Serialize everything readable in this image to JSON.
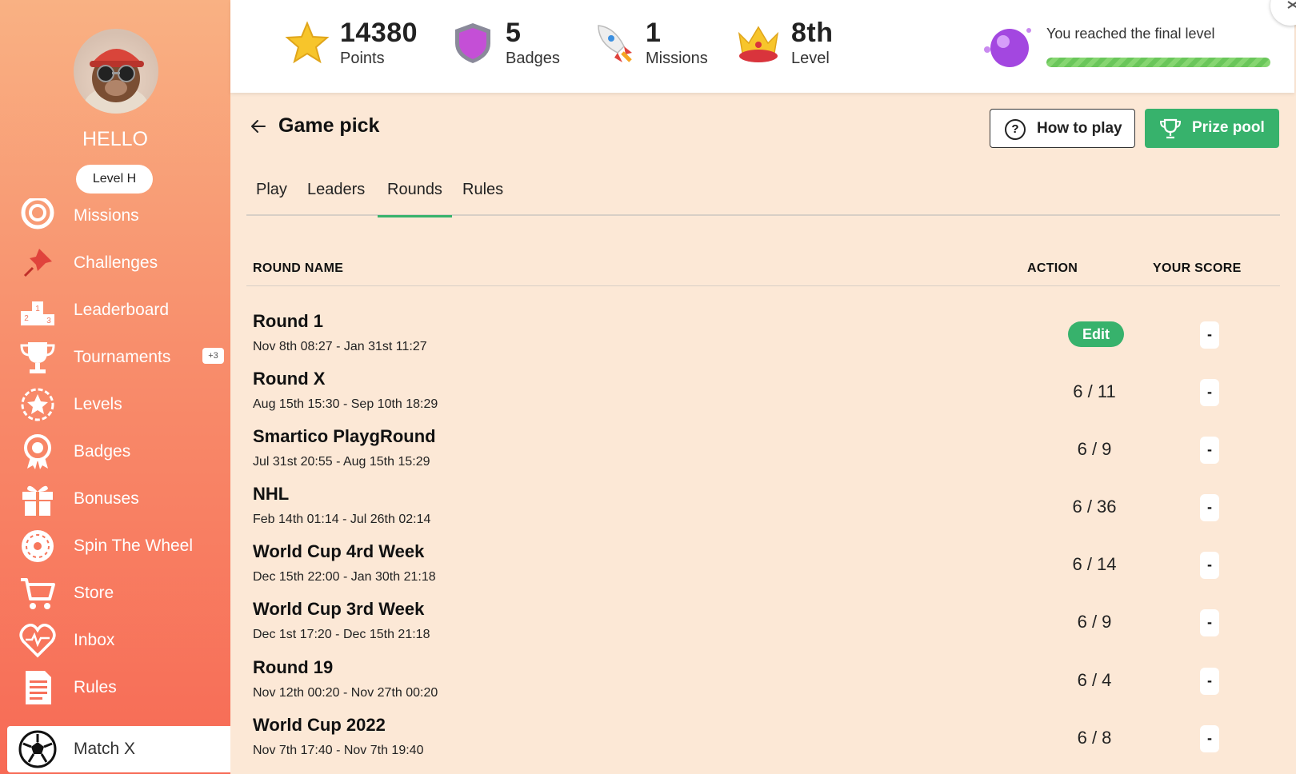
{
  "sidebar": {
    "greeting": "HELLO",
    "level": "Level H",
    "items": [
      {
        "label": "Missions",
        "icon": "target-icon"
      },
      {
        "label": "Challenges",
        "icon": "pin-icon"
      },
      {
        "label": "Leaderboard",
        "icon": "podium-icon"
      },
      {
        "label": "Tournaments",
        "icon": "trophy-icon",
        "badge": "+3"
      },
      {
        "label": "Levels",
        "icon": "star-badge-icon"
      },
      {
        "label": "Badges",
        "icon": "medal-icon"
      },
      {
        "label": "Bonuses",
        "icon": "gift-icon"
      },
      {
        "label": "Spin The Wheel",
        "icon": "wheel-icon"
      },
      {
        "label": "Store",
        "icon": "cart-icon"
      },
      {
        "label": "Inbox",
        "icon": "heart-pulse-icon"
      },
      {
        "label": "Rules",
        "icon": "document-icon"
      },
      {
        "label": "Match X",
        "icon": "soccer-ball-icon",
        "active": true
      }
    ]
  },
  "stats": {
    "points": {
      "value": "14380",
      "label": "Points"
    },
    "badges": {
      "value": "5",
      "label": "Badges"
    },
    "missions": {
      "value": "1",
      "label": "Missions"
    },
    "level": {
      "value": "8th",
      "label": "Level"
    },
    "final_level_text": "You reached the final level",
    "final_level_progress": 1.0
  },
  "main": {
    "title": "Game pick",
    "how_to_play": "How to play",
    "prize_pool": "Prize pool",
    "tabs": [
      "Play",
      "Leaders",
      "Rounds",
      "Rules"
    ],
    "active_tab": "Rounds",
    "columns": {
      "round_name": "ROUND NAME",
      "action": "ACTION",
      "your_score": "YOUR SCORE"
    },
    "rounds": [
      {
        "name": "Round 1",
        "dates": "Nov 8th 08:27 - Jan 31st 11:27",
        "action": "Edit",
        "score": "-"
      },
      {
        "name": "Round X",
        "dates": "Aug 15th 15:30 - Sep 10th 18:29",
        "action": "6 / 11",
        "score": "-"
      },
      {
        "name": "Smartico PlaygRound",
        "dates": "Jul 31st 20:55 - Aug 15th 15:29",
        "action": "6 / 9",
        "score": "-"
      },
      {
        "name": "NHL",
        "dates": "Feb 14th 01:14 - Jul 26th 02:14",
        "action": "6 / 36",
        "score": "-"
      },
      {
        "name": "World Cup 4rd Week",
        "dates": "Dec 15th 22:00 - Jan 30th 21:18",
        "action": "6 / 14",
        "score": "-"
      },
      {
        "name": "World Cup 3rd Week",
        "dates": "Dec 1st 17:20 - Dec 15th 21:18",
        "action": "6 / 9",
        "score": "-"
      },
      {
        "name": "Round 19",
        "dates": "Nov 12th 00:20 - Nov 27th 00:20",
        "action": "6 / 4",
        "score": "-"
      },
      {
        "name": "World Cup 2022",
        "dates": "Nov 7th 17:40 - Nov 7th 19:40",
        "action": "6 / 8",
        "score": "-"
      }
    ]
  },
  "colors": {
    "accent_green": "#37b26c",
    "sidebar_top": "#f9b183",
    "sidebar_bottom": "#f76a55",
    "page_bg": "#fce8d6"
  }
}
